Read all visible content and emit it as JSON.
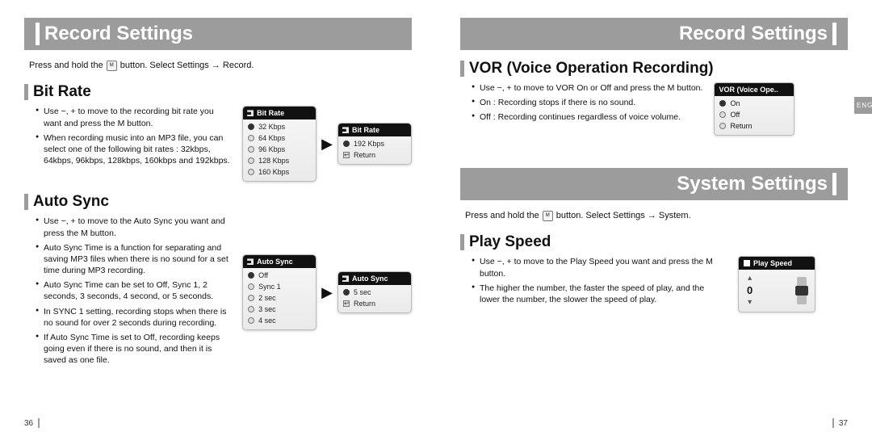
{
  "left": {
    "title": "Record Settings",
    "instruction_pre": "Press and hold the",
    "instruction_post": "button. Select Settings → Record.",
    "bit_rate": {
      "heading": "Bit Rate",
      "bullets": [
        "Use −, + to move to the recording bit rate you want and press the M button.",
        "When recording music into an MP3 file, you can select one of the following bit rates : 32kbps, 64kbps, 96kbps, 128kbps, 160kbps and 192kbps."
      ],
      "menu_a": {
        "title": "Bit Rate",
        "items": [
          "32 Kbps",
          "64 Kbps",
          "96 Kbps",
          "128 Kbps",
          "160 Kbps"
        ]
      },
      "menu_b": {
        "title": "Bit Rate",
        "items": [
          "192 Kbps",
          "Return"
        ]
      }
    },
    "auto_sync": {
      "heading": "Auto Sync",
      "bullets": [
        "Use −, + to move to the Auto Sync you want and press the M button.",
        "Auto Sync Time is a function for separating and saving MP3 files when there is no sound for a set time during MP3 recording.",
        "Auto Sync Time can be set to Off, Sync 1, 2 seconds, 3 seconds, 4 second, or 5 seconds.",
        "In SYNC 1 setting, recording stops when there is no sound for over 2 seconds during recording.",
        "If Auto Sync Time is set to Off, recording keeps going even if there is no sound, and then it is saved as one file."
      ],
      "menu_a": {
        "title": "Auto Sync",
        "items": [
          "Off",
          "Sync 1",
          "2 sec",
          "3 sec",
          "4 sec"
        ]
      },
      "menu_b": {
        "title": "Auto Sync",
        "items": [
          "5 sec",
          "Return"
        ]
      }
    },
    "page_no": "36"
  },
  "right": {
    "title": "Record Settings",
    "vor": {
      "heading": "VOR (Voice Operation Recording)",
      "bullets": [
        "Use −, + to move to VOR On or Off and press the M button.",
        "On : Recording stops if there is no sound.",
        "Off : Recording continues regardless of voice volume."
      ],
      "panel": {
        "title": "VOR (Voice Ope..",
        "items": [
          "On",
          "Off",
          "Return"
        ]
      }
    },
    "system_title": "System Settings",
    "sys_instruction_pre": "Press and hold the",
    "sys_instruction_post": "button. Select Settings → System.",
    "play_speed": {
      "heading": "Play Speed",
      "bullets": [
        "Use −, + to move to the Play Speed you want and press the M button.",
        "The higher the number, the faster the speed of play, and the lower the number, the slower the speed of play."
      ],
      "panel": {
        "title": "Play Speed",
        "value": "0",
        "up": "▴",
        "down": "▾"
      }
    },
    "eng_tab": "ENG",
    "page_no": "37"
  }
}
